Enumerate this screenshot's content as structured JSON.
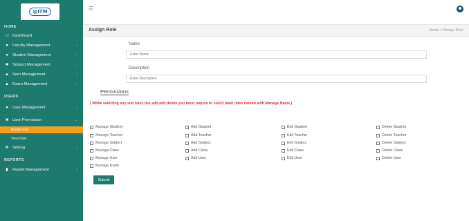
{
  "sidebar": {
    "sections": {
      "home": "HOME",
      "users": "USERS",
      "reports": "REPORTS"
    },
    "items": [
      {
        "label": "Dashboard",
        "icon": "monitor-icon"
      },
      {
        "label": "Faculty Management",
        "icon": "user-icon"
      },
      {
        "label": "Student Management",
        "icon": "users-icon"
      },
      {
        "label": "Subject Management",
        "icon": "book-icon"
      },
      {
        "label": "Sem Management",
        "icon": "graduation-cap-icon"
      },
      {
        "label": "Exam Management",
        "icon": "graduation-cap-icon"
      },
      {
        "label": "User Management",
        "icon": "users-icon"
      },
      {
        "label": "User Permission",
        "icon": "lock-icon"
      },
      {
        "label": "Setting",
        "icon": "gear-icon"
      },
      {
        "label": "Report Management",
        "icon": "file-icon"
      }
    ],
    "subitems": {
      "assign_role": "Assign role",
      "view_role": "View Role"
    }
  },
  "header": {
    "title": "Assign Role",
    "breadcrumb": "Home > Assign Role"
  },
  "form": {
    "name_label": "Name",
    "name_placeholder": "Enter Name",
    "description_label": "Description",
    "description_placeholder": "Enter Description",
    "permissions_title": "Permissions",
    "permissions_note": "( While selecting any sub roles like add,edit,delete you must require to select Main roles named with Manage Name.)",
    "permissions": [
      [
        "Manage Student",
        "Add Student",
        "Edit Student",
        "Delete Student"
      ],
      [
        "Manage Teacher",
        "Add Teacher",
        "Edit Teacher",
        "Delete Teacher"
      ],
      [
        "Manage Subject",
        "Add Subject",
        "Edit Subject",
        "Delete Subject"
      ],
      [
        "Manage Class",
        "Add Class",
        "Edit Class",
        "Delete Class"
      ],
      [
        "Manage User",
        "Add User",
        "Edit User",
        "Delete User"
      ],
      [
        "Manage Exam"
      ]
    ],
    "submit_label": "Submit"
  },
  "colors": {
    "sidebar": "#1f7a6e",
    "active": "#f59e1c",
    "note": "#e0302a",
    "button": "#1f7a6e"
  }
}
